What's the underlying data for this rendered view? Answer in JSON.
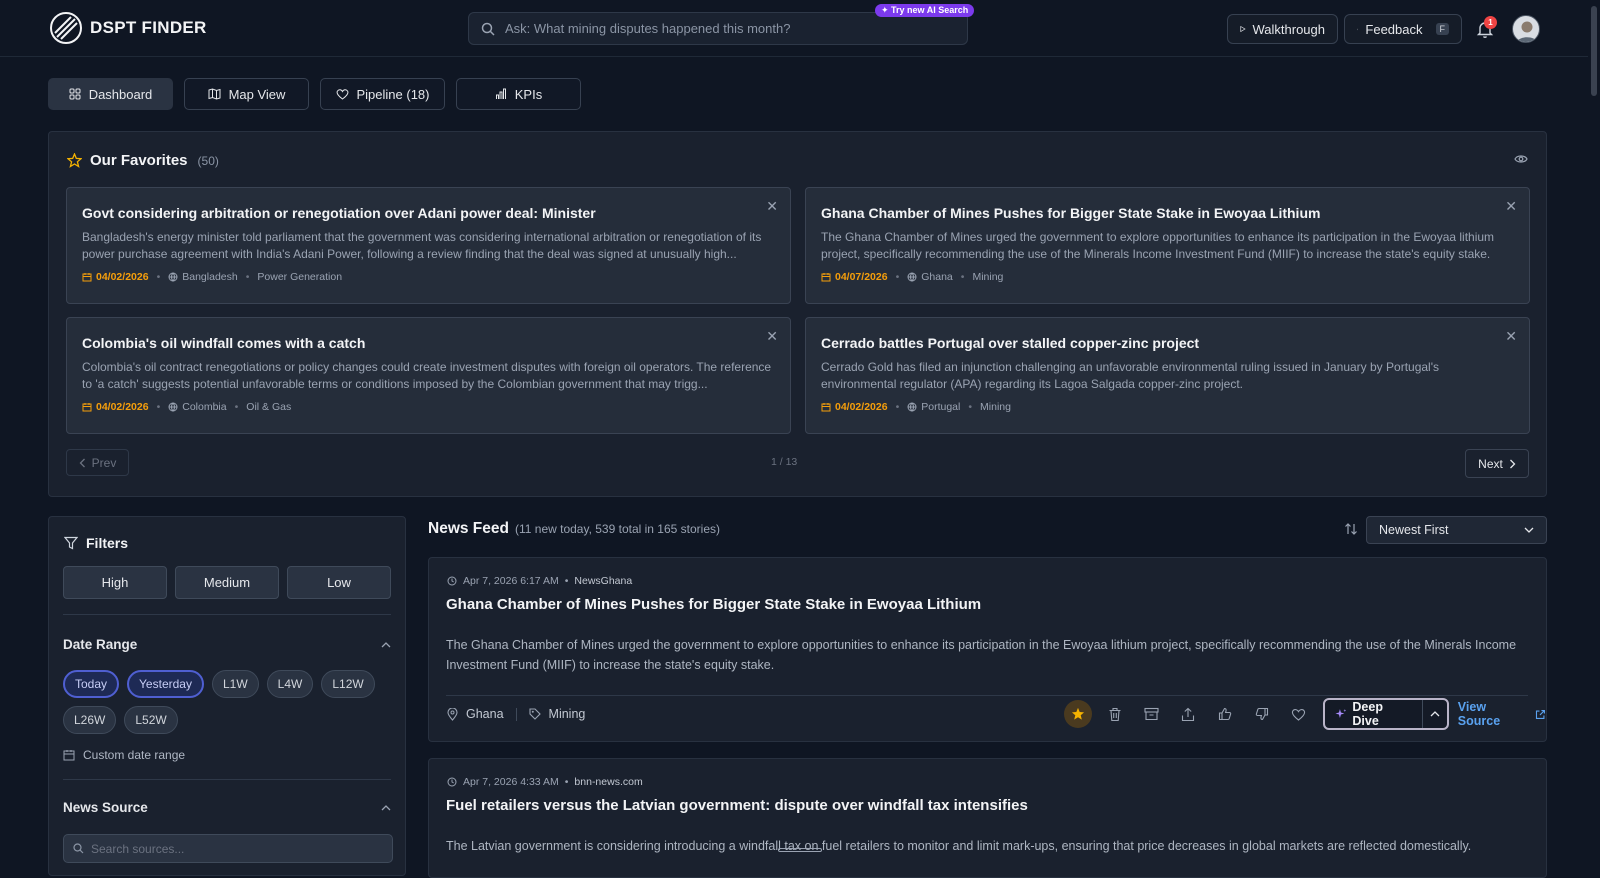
{
  "brand": {
    "name": "DSPT FINDER"
  },
  "search": {
    "placeholder": "Ask: What mining disputes happened this month?",
    "ai_badge": "✦ Try new AI Search"
  },
  "topbar": {
    "walkthrough": "Walkthrough",
    "feedback": "Feedback",
    "feedback_key": "F",
    "notifications": "1"
  },
  "tabs": [
    {
      "label": "Dashboard",
      "icon": "grid-icon"
    },
    {
      "label": "Map View",
      "icon": "map-icon"
    },
    {
      "label": "Pipeline (18)",
      "icon": "heart-icon"
    },
    {
      "label": "KPIs",
      "icon": "bar-chart-icon"
    }
  ],
  "favorites": {
    "title": "Our Favorites",
    "count": "(50)",
    "cards": [
      {
        "title": "Govt considering arbitration or renegotiation over Adani power deal: Minister",
        "desc": "Bangladesh's energy minister told parliament that the government was considering international arbitration or renegotiation of its power purchase agreement with India's Adani Power, following a review finding that the deal was signed at unusually high...",
        "date": "04/02/2026",
        "country": "Bangladesh",
        "sector": "Power Generation"
      },
      {
        "title": "Ghana Chamber of Mines Pushes for Bigger State Stake in Ewoyaa Lithium",
        "desc": "The Ghana Chamber of Mines urged the government to explore opportunities to enhance its participation in the Ewoyaa lithium project, specifically recommending the use of the Minerals Income Investment Fund (MIIF) to increase the state's equity stake.",
        "date": "04/07/2026",
        "country": "Ghana",
        "sector": "Mining"
      },
      {
        "title": "Colombia's oil windfall comes with a catch",
        "desc": "Colombia's oil contract renegotiations or policy changes could create investment disputes with foreign oil operators. The reference to 'a catch' suggests potential unfavorable terms or conditions imposed by the Colombian government that may trigg...",
        "date": "04/02/2026",
        "country": "Colombia",
        "sector": "Oil & Gas"
      },
      {
        "title": "Cerrado battles Portugal over stalled copper-zinc project",
        "desc": "Cerrado Gold has filed an injunction challenging an unfavorable environmental ruling issued in January by Portugal's environmental regulator (APA) regarding its Lagoa Salgada copper-zinc project.",
        "date": "04/02/2026",
        "country": "Portugal",
        "sector": "Mining"
      }
    ],
    "prev": "Prev",
    "next": "Next",
    "page": "1 / 13"
  },
  "filters": {
    "title": "Filters",
    "priorities": [
      "High",
      "Medium",
      "Low"
    ],
    "date_range": {
      "title": "Date Range",
      "chips": [
        "Today",
        "Yesterday",
        "L1W",
        "L4W",
        "L12W",
        "L26W",
        "L52W"
      ],
      "custom": "Custom date range"
    },
    "news_source": {
      "title": "News Source",
      "placeholder": "Search sources..."
    }
  },
  "feed": {
    "title": "News Feed",
    "subtitle": "(11 new today, 539 total in 165 stories)",
    "sort": "Newest First",
    "stories": [
      {
        "time": "Apr 7, 2026 6:17 AM",
        "source": "NewsGhana",
        "title": "Ghana Chamber of Mines Pushes for Bigger State Stake in Ewoyaa Lithium",
        "desc": "The Ghana Chamber of Mines urged the government to explore opportunities to enhance its participation in the Ewoyaa lithium project, specifically recommending the use of the Minerals Income Investment Fund (MIIF) to increase the state's equity stake.",
        "country": "Ghana",
        "sector": "Mining",
        "deep_dive": "Deep Dive",
        "view_source": "View Source"
      },
      {
        "time": "Apr 7, 2026 4:33 AM",
        "source": "bnn-news.com",
        "title": "Fuel retailers versus the Latvian government: dispute over windfall tax intensifies",
        "desc": "The Latvian government is considering introducing a windfall tax on fuel retailers to monitor and limit mark-ups, ensuring that price decreases in global markets are reflected domestically."
      }
    ]
  },
  "colors": {
    "accent": "#4f5fd1",
    "date": "#f59e0b",
    "link": "#5aa2f0",
    "badge": "#7c3aed"
  }
}
